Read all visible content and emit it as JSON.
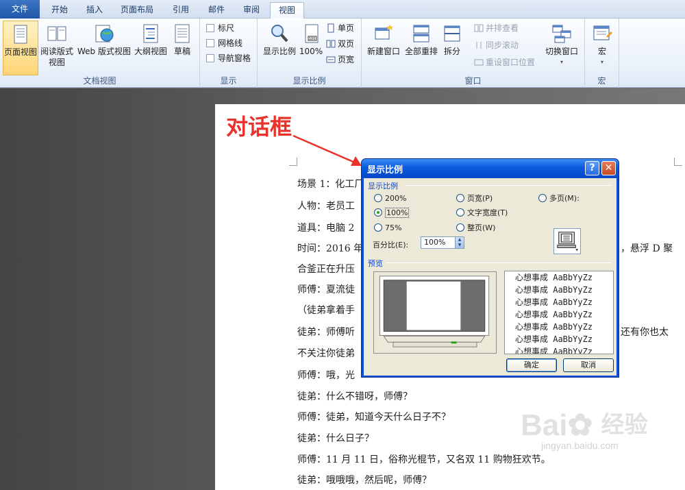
{
  "tabs": [
    "文件",
    "开始",
    "插入",
    "页面布局",
    "引用",
    "邮件",
    "审阅",
    "视图"
  ],
  "active_tab": "视图",
  "ribbon": {
    "doc_views": {
      "label": "文档视图",
      "page_view": "页面视图",
      "reading_view_1": "阅读版式",
      "reading_view_2": "视图",
      "web_view": "Web 版式视图",
      "outline_view": "大纲视图",
      "draft": "草稿"
    },
    "show": {
      "label": "显示",
      "ruler": "标尺",
      "gridlines": "网格线",
      "nav_pane": "导航窗格"
    },
    "zoom": {
      "label": "显示比例",
      "zoom_btn": "显示比例",
      "hundred": "100%",
      "one_page": "单页",
      "two_pages": "双页",
      "page_width": "页宽"
    },
    "window": {
      "label": "窗口",
      "new_window": "新建窗口",
      "arrange_all": "全部重排",
      "split": "拆分",
      "side_by_side": "并排查看",
      "sync_scroll": "同步滚动",
      "reset_pos": "重设窗口位置",
      "switch_window": "切换窗口"
    },
    "macros": {
      "label": "宏",
      "macros_btn": "宏"
    }
  },
  "annotation": "对话框",
  "document": {
    "lines": [
      "场景 1：化工厂",
      "人物：老员工",
      "道具：电脑 2",
      "时间：2016 年",
      "合釜正在升压",
      "师傅：夏流徒",
      "（徒弟拿着手",
      "徒弟：师傅听",
      "不关注你徒弟",
      "师傅：哦，光",
      "徒弟：什么不错呀，师傅？",
      "师傅：徒弟，知道今天什么日子不？",
      "徒弟：什么日子？",
      "师傅：11 月 11 日，俗称光棍节，又名双 11 购物狂欢节。",
      "徒弟：哦哦哦，然后呢，师傅？"
    ],
    "right_fragment_1": "，悬浮 D 聚",
    "right_fragment_2": "还有你也太"
  },
  "dialog": {
    "title": "显示比例",
    "section_zoom": "显示比例",
    "opt_200": "200%",
    "opt_100": "100%",
    "opt_75": "75%",
    "opt_page_width": "页宽(P)",
    "opt_text_width": "文字宽度(T)",
    "opt_whole_page": "整页(W)",
    "opt_many_pages": "多页(M):",
    "percent_label": "百分比(E):",
    "percent_value": "100%",
    "section_preview": "预览",
    "sample_text": "心想事成 AaBbYyZz",
    "ok": "确定",
    "cancel": "取消"
  },
  "watermark": {
    "brand": "Bai",
    "brand_end": "经验",
    "url": "jingyan.baidu.com"
  }
}
